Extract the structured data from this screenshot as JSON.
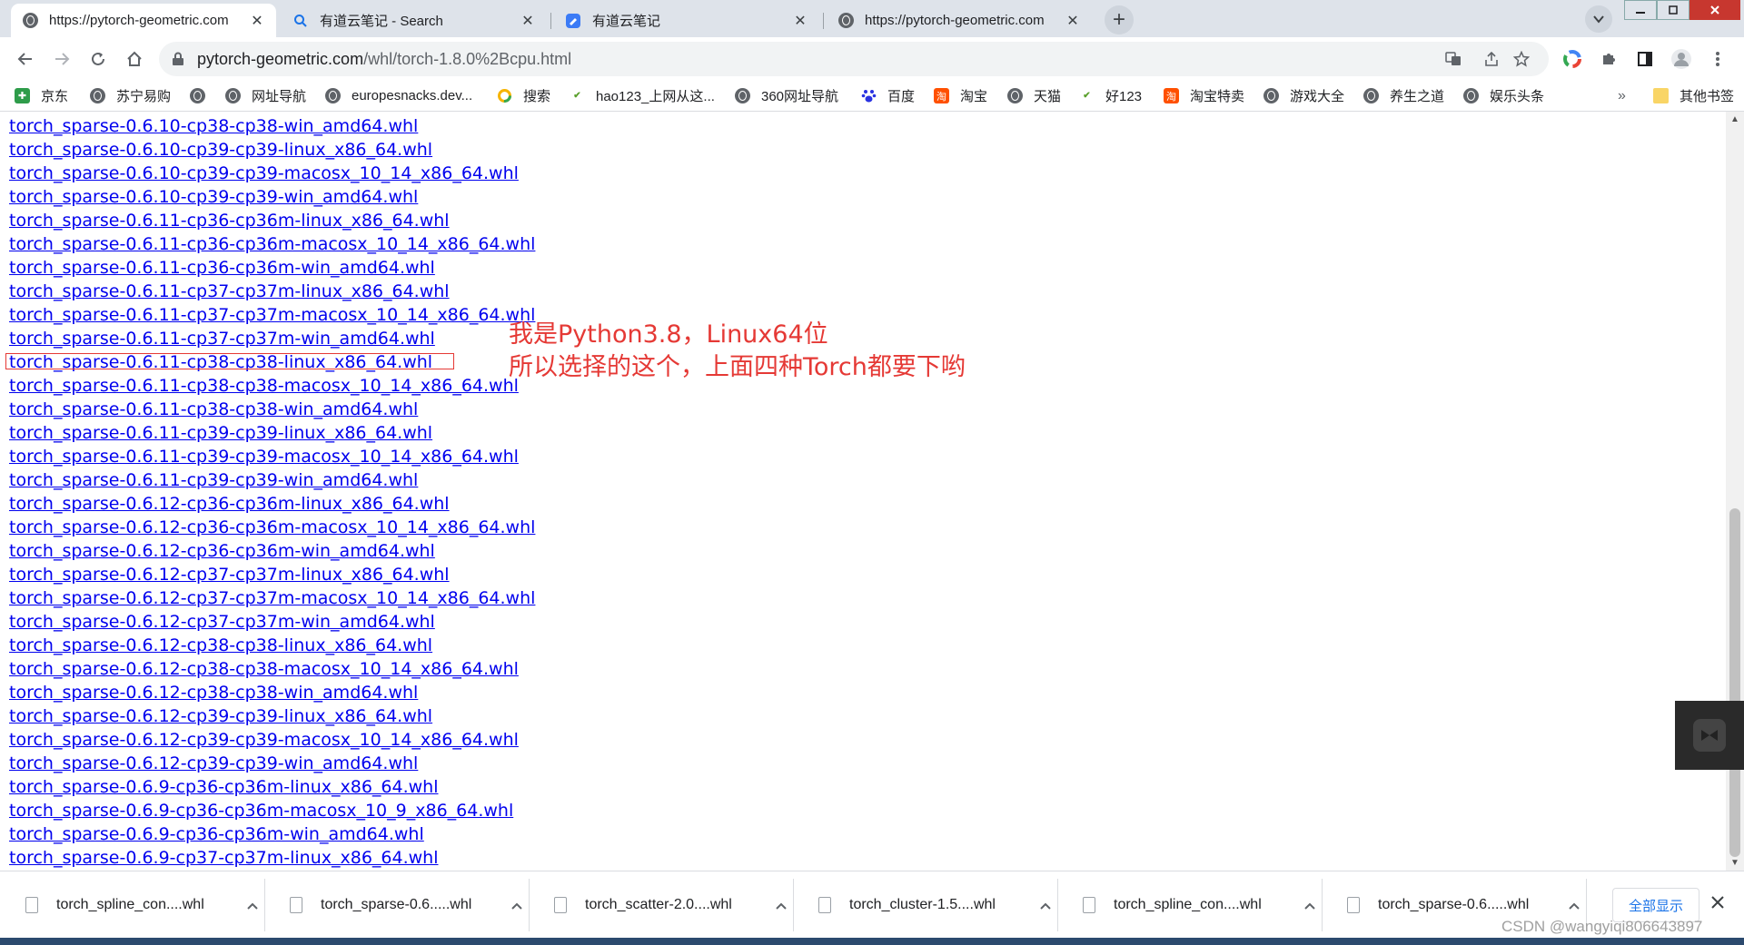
{
  "tabs": [
    {
      "title": "https://pytorch-geometric.com",
      "favicon": "globe-icon",
      "active": true
    },
    {
      "title": "有道云笔记 - Search",
      "favicon": "search-icon",
      "active": false
    },
    {
      "title": "有道云笔记",
      "favicon": "note-icon",
      "active": false
    },
    {
      "title": "https://pytorch-geometric.com",
      "favicon": "globe-icon",
      "active": false
    }
  ],
  "tab_close_glyph": "✕",
  "new_tab_glyph": "+",
  "address": {
    "host": "pytorch-geometric.com",
    "path": "/whl/torch-1.8.0%2Bcpu.html"
  },
  "bookmarks": [
    {
      "label": "京东",
      "icon": "jd-icon",
      "color": "#2e9c4a"
    },
    {
      "label": "苏宁易购",
      "icon": "globe-icon"
    },
    {
      "label": "",
      "icon": "globe-icon"
    },
    {
      "label": "网址导航",
      "icon": "globe-icon"
    },
    {
      "label": "europesnacks.dev...",
      "icon": "globe-icon"
    },
    {
      "label": "搜索",
      "icon": "search-circle-icon",
      "color": "#f6b400"
    },
    {
      "label": "hao123_上网从这...",
      "icon": "hao123-icon",
      "color": "#5aa02c"
    },
    {
      "label": "360网址导航",
      "icon": "globe-icon"
    },
    {
      "label": "百度",
      "icon": "baidu-paw-icon",
      "color": "#2932e1"
    },
    {
      "label": "淘宝",
      "icon": "taobao-icon",
      "color": "#ff5000"
    },
    {
      "label": "天猫",
      "icon": "globe-icon"
    },
    {
      "label": "好123",
      "icon": "hao123-icon",
      "color": "#5aa02c"
    },
    {
      "label": "淘宝特卖",
      "icon": "taobao-icon",
      "color": "#ff5000"
    },
    {
      "label": "游戏大全",
      "icon": "globe-icon"
    },
    {
      "label": "养生之道",
      "icon": "globe-icon"
    },
    {
      "label": "娱乐头条",
      "icon": "globe-icon"
    }
  ],
  "bookmarks_overflow": "»",
  "other_bookmarks": "其他书签",
  "links": [
    "torch_sparse-0.6.10-cp38-cp38-win_amd64.whl",
    "torch_sparse-0.6.10-cp39-cp39-linux_x86_64.whl",
    "torch_sparse-0.6.10-cp39-cp39-macosx_10_14_x86_64.whl",
    "torch_sparse-0.6.10-cp39-cp39-win_amd64.whl",
    "torch_sparse-0.6.11-cp36-cp36m-linux_x86_64.whl",
    "torch_sparse-0.6.11-cp36-cp36m-macosx_10_14_x86_64.whl",
    "torch_sparse-0.6.11-cp36-cp36m-win_amd64.whl",
    "torch_sparse-0.6.11-cp37-cp37m-linux_x86_64.whl",
    "torch_sparse-0.6.11-cp37-cp37m-macosx_10_14_x86_64.whl",
    "torch_sparse-0.6.11-cp37-cp37m-win_amd64.whl",
    "torch_sparse-0.6.11-cp38-cp38-linux_x86_64.whl",
    "torch_sparse-0.6.11-cp38-cp38-macosx_10_14_x86_64.whl",
    "torch_sparse-0.6.11-cp38-cp38-win_amd64.whl",
    "torch_sparse-0.6.11-cp39-cp39-linux_x86_64.whl",
    "torch_sparse-0.6.11-cp39-cp39-macosx_10_14_x86_64.whl",
    "torch_sparse-0.6.11-cp39-cp39-win_amd64.whl",
    "torch_sparse-0.6.12-cp36-cp36m-linux_x86_64.whl",
    "torch_sparse-0.6.12-cp36-cp36m-macosx_10_14_x86_64.whl",
    "torch_sparse-0.6.12-cp36-cp36m-win_amd64.whl",
    "torch_sparse-0.6.12-cp37-cp37m-linux_x86_64.whl",
    "torch_sparse-0.6.12-cp37-cp37m-macosx_10_14_x86_64.whl",
    "torch_sparse-0.6.12-cp37-cp37m-win_amd64.whl",
    "torch_sparse-0.6.12-cp38-cp38-linux_x86_64.whl",
    "torch_sparse-0.6.12-cp38-cp38-macosx_10_14_x86_64.whl",
    "torch_sparse-0.6.12-cp38-cp38-win_amd64.whl",
    "torch_sparse-0.6.12-cp39-cp39-linux_x86_64.whl",
    "torch_sparse-0.6.12-cp39-cp39-macosx_10_14_x86_64.whl",
    "torch_sparse-0.6.12-cp39-cp39-win_amd64.whl",
    "torch_sparse-0.6.9-cp36-cp36m-linux_x86_64.whl",
    "torch_sparse-0.6.9-cp36-cp36m-macosx_10_9_x86_64.whl",
    "torch_sparse-0.6.9-cp36-cp36m-win_amd64.whl",
    "torch_sparse-0.6.9-cp37-cp37m-linux_x86_64.whl"
  ],
  "annotation": {
    "line1": "我是Python3.8，Linux64位",
    "line2": "所以选择的这个，上面四种Torch都要下哟",
    "color": "#e53935"
  },
  "downloads": [
    "torch_spline_con....whl",
    "torch_sparse-0.6.....whl",
    "torch_scatter-2.0....whl",
    "torch_cluster-1.5....whl",
    "torch_spline_con....whl",
    "torch_sparse-0.6.....whl"
  ],
  "show_all": "全部显示",
  "watermark": "CSDN @wangyiqi806643897"
}
